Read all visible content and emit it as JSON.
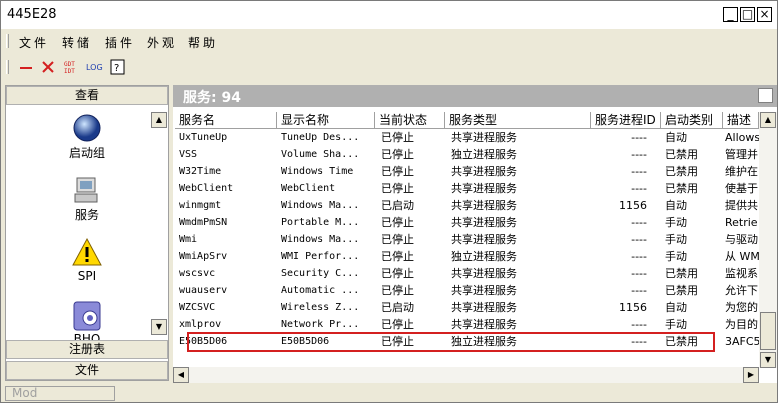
{
  "window": {
    "title": "445E28"
  },
  "menu": [
    "文件",
    "转储",
    "插件",
    "外观",
    "帮助"
  ],
  "toolbar": {
    "gdt_label": "GDT\nIDT",
    "log_label": "LOG"
  },
  "sidebar": {
    "top_header": "查看",
    "items": [
      {
        "label": "启动组",
        "icon": "startup-group-icon"
      },
      {
        "label": "服务",
        "icon": "services-icon"
      },
      {
        "label": "SPI",
        "icon": "spi-warning-icon"
      },
      {
        "label": "BHO",
        "icon": "bho-icon"
      }
    ],
    "bottom_headers": [
      "注册表",
      "文件"
    ]
  },
  "main": {
    "heading": "服务: 94",
    "columns": [
      "服务名",
      "显示名称",
      "当前状态",
      "服务类型",
      "服务进程ID",
      "启动类别",
      "描述"
    ],
    "rows": [
      [
        "UxTuneUp",
        "TuneUp Des...",
        "已停止",
        "共享进程服务",
        "----",
        "自动",
        "Allows"
      ],
      [
        "VSS",
        "Volume Sha...",
        "已停止",
        "独立进程服务",
        "----",
        "已禁用",
        "管理并"
      ],
      [
        "W32Time",
        "Windows Time",
        "已停止",
        "共享进程服务",
        "----",
        "已禁用",
        "维护在"
      ],
      [
        "WebClient",
        "WebClient",
        "已停止",
        "共享进程服务",
        "----",
        "已禁用",
        "使基于"
      ],
      [
        "winmgmt",
        "Windows Ma...",
        "已启动",
        "共享进程服务",
        "1156",
        "自动",
        "提供共"
      ],
      [
        "WmdmPmSN",
        "Portable M...",
        "已停止",
        "共享进程服务",
        "----",
        "手动",
        "Retrie"
      ],
      [
        "Wmi",
        "Windows Ma...",
        "已停止",
        "共享进程服务",
        "----",
        "手动",
        "与驱动"
      ],
      [
        "WmiApSrv",
        "WMI Perfor...",
        "已停止",
        "独立进程服务",
        "----",
        "手动",
        "从 WMI"
      ],
      [
        "wscsvc",
        "Security C...",
        "已停止",
        "共享进程服务",
        "----",
        "已禁用",
        "监视系"
      ],
      [
        "wuauserv",
        "Automatic ...",
        "已停止",
        "共享进程服务",
        "----",
        "已禁用",
        "允许下"
      ],
      [
        "WZCSVC",
        "Wireless Z...",
        "已启动",
        "共享进程服务",
        "1156",
        "自动",
        "为您的"
      ],
      [
        "xmlprov",
        "Network Pr...",
        "已停止",
        "共享进程服务",
        "----",
        "手动",
        "为目的"
      ],
      [
        "E50B5D06",
        "E50B5D06",
        "已停止",
        "独立进程服务",
        "----",
        "已禁用",
        "3AFC50"
      ]
    ],
    "highlighted_row": 12,
    "highlight_color": "#d42020"
  },
  "status": {
    "panel_text": "Mod"
  }
}
